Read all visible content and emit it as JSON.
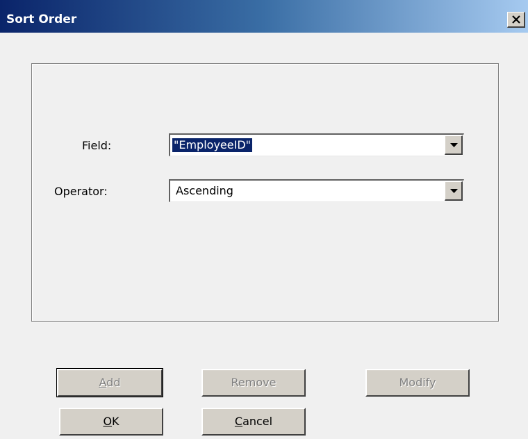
{
  "window": {
    "title": "Sort Order",
    "close_glyph": "✕"
  },
  "form": {
    "field_label": "Field:",
    "field_value": "\"EmployeeID\"",
    "operator_label": "Operator:",
    "operator_value": "Ascending"
  },
  "buttons": {
    "add": {
      "accel": "A",
      "rest": "dd",
      "enabled": false
    },
    "remove": {
      "label": "Remove",
      "enabled": false
    },
    "modify": {
      "label": "Modify",
      "enabled": false
    },
    "ok": {
      "accel": "O",
      "rest": "K",
      "enabled": true
    },
    "cancel": {
      "accel": "C",
      "rest": "ancel",
      "enabled": true
    }
  },
  "icons": {
    "close": "close-icon",
    "dropdown": "chevron-down-icon"
  },
  "colors": {
    "title_gradient_start": "#0a246a",
    "title_gradient_end": "#a6caf0",
    "selection": "#0a246a",
    "face": "#d4d0c8",
    "background": "#f0f0f0"
  }
}
